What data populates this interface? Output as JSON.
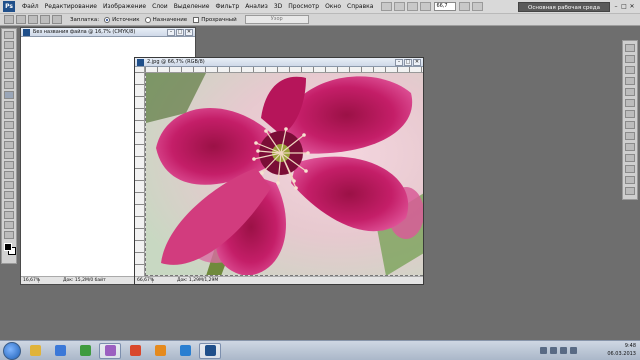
{
  "app": {
    "logo": "Ps",
    "menu": [
      "Файл",
      "Редактирование",
      "Изображение",
      "Слои",
      "Выделение",
      "Фильтр",
      "Анализ",
      "3D",
      "Просмотр",
      "Окно",
      "Справка"
    ],
    "zoom": "66,7",
    "workspace_button": "Основная рабочая среда",
    "window_controls": [
      "–",
      "□",
      "✕"
    ]
  },
  "options_bar": {
    "tool_icon": "patch-tool-icon",
    "mode_label": "Заплатка:",
    "source_label": "Источник",
    "destination_label": "Назначение",
    "transparent_label": "Прозрачный",
    "pattern_button": "Узор"
  },
  "documents": [
    {
      "title": "Без названия файла @ 16,7% (CMYK/8)",
      "zoom": "16,67%",
      "info": "Док: 15,2M/0 байт"
    },
    {
      "title": "2.jpg @ 66,7% (RGB/8)",
      "zoom": "66,67%",
      "info": "Док: 1,29M/1,29M"
    }
  ],
  "doc_controls": [
    "–",
    "□",
    "✕"
  ],
  "taskbar": {
    "time": "9:48",
    "date": "06.03.2013",
    "apps": [
      {
        "name": "explorer",
        "color": "#e0b33a"
      },
      {
        "name": "media-player",
        "color": "#3b78d8"
      },
      {
        "name": "paint",
        "color": "#3f9b3f"
      },
      {
        "name": "photo-viewer",
        "color": "#9b5fc0"
      },
      {
        "name": "chrome",
        "color": "#d9472b"
      },
      {
        "name": "firefox",
        "color": "#e58a1e"
      },
      {
        "name": "ie",
        "color": "#2a7fd1"
      },
      {
        "name": "photoshop",
        "color": "#1f4f8a"
      }
    ]
  },
  "colors": {
    "workspace_bg": "#6e6e6e",
    "flower": "#c41e68",
    "flower_light": "#e0559a",
    "stamen": "#f0d6c0"
  }
}
